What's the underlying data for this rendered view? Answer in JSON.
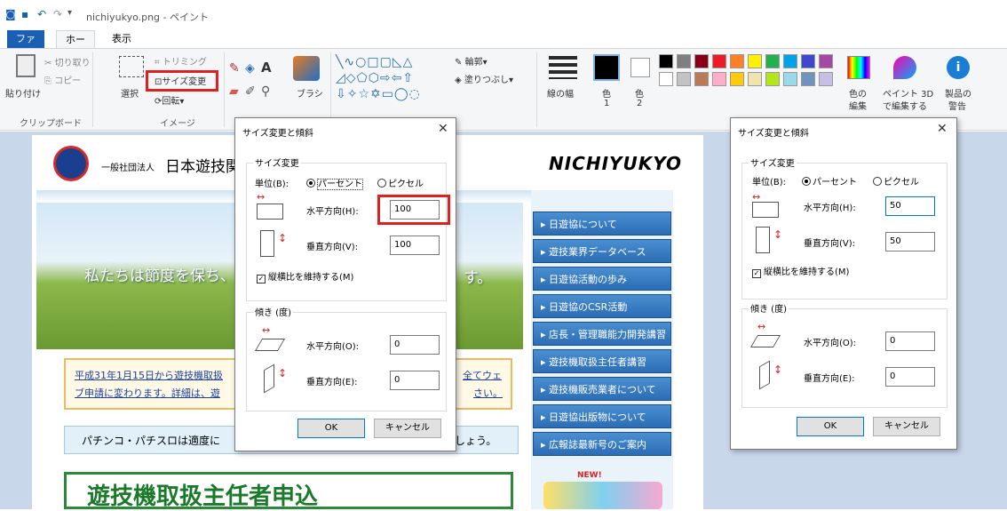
{
  "window": {
    "title": "nichiyukyo.png - ペイント"
  },
  "tabs": {
    "file": "ファイル",
    "home": "ホーム",
    "view": "表示"
  },
  "ribbon": {
    "paste": "貼り付け",
    "cut": "切り取り",
    "copy": "コピー",
    "clipboard_group": "クリップボード",
    "select": "選択",
    "crop": "トリミング",
    "resize": "サイズ変更",
    "rotate": "回転",
    "image_group": "イメージ",
    "brush": "ブラシ",
    "outline": "輪郭",
    "fill": "塗りつぶし",
    "line_width": "線の幅",
    "color1": "色",
    "color1_n": "1",
    "color2": "色",
    "color2_n": "2",
    "edit_colors_1": "色の",
    "edit_colors_2": "編集",
    "paint3d_1": "ペイント 3D",
    "paint3d_2": "で編集する",
    "warn_1": "製品の",
    "warn_2": "警告",
    "palette": [
      "#000000",
      "#7f7f7f",
      "#880015",
      "#ed1c24",
      "#ff7f27",
      "#fff200",
      "#22b14c",
      "#00a2e8",
      "#3f48cc",
      "#a349a4",
      "#ffffff",
      "#c3c3c3",
      "#b97a57",
      "#ffaec9",
      "#ffc90e",
      "#efe4b0",
      "#b5e61d",
      "#99d9ea",
      "#7092be",
      "#c8bfe7"
    ]
  },
  "website": {
    "org_prefix": "一般社団法人",
    "org_name": "日本遊技関",
    "brand": "NICHIYUKYO",
    "hero_text": "私たちは節度を保ち、",
    "hero_text_end": "す。",
    "notice_l1": "平成31年1月15日から遊技機取扱",
    "notice_l1_end": "全てウェ",
    "notice_l2": "ブ申請に変わります。詳細は、遊",
    "notice_l2_end": "さい。",
    "banner": "パチンコ・パチスロは適度に",
    "banner_end": "しょう。",
    "bottom_banner": "遊技機取扱主任者申込",
    "new_badge": "NEW!",
    "nav": [
      "日遊協について",
      "遊技業界データベース",
      "日遊協活動の歩み",
      "日遊協のCSR活動",
      "店長・管理職能力開発講習",
      "遊技機取扱主任者講習",
      "遊技機販売業者について",
      "日遊協出版物について",
      "広報誌最新号のご案内"
    ]
  },
  "dialog1": {
    "title": "サイズ変更と傾斜",
    "resize": "サイズ変更",
    "unit": "単位(B):",
    "percent": "パーセント",
    "pixel": "ピクセル",
    "h": "水平方向(H):",
    "v": "垂直方向(V):",
    "h_val": "100",
    "v_val": "100",
    "keep": "縦横比を維持する(M)",
    "skew": "傾き (度)",
    "sh": "水平方向(O):",
    "sv": "垂直方向(E):",
    "sh_val": "0",
    "sv_val": "0",
    "ok": "OK",
    "cancel": "キャンセル"
  },
  "dialog2": {
    "title": "サイズ変更と傾斜",
    "resize": "サイズ変更",
    "unit": "単位(B):",
    "percent": "パーセント",
    "pixel": "ピクセル",
    "h": "水平方向(H):",
    "v": "垂直方向(V):",
    "h_val": "50",
    "v_val": "50",
    "keep": "縦横比を維持する(M)",
    "skew": "傾き (度)",
    "sh": "水平方向(O):",
    "sv": "垂直方向(E):",
    "sh_val": "0",
    "sv_val": "0",
    "ok": "OK",
    "cancel": "キャンセル"
  }
}
